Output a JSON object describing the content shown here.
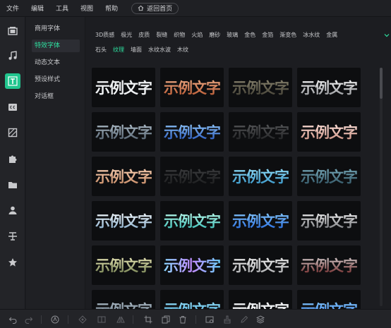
{
  "menubar": {
    "items": [
      "文件",
      "编辑",
      "工具",
      "视图",
      "帮助"
    ],
    "home_button": "返回首页"
  },
  "rail": {
    "items": [
      {
        "icon": "media-icon",
        "active": false
      },
      {
        "icon": "music-icon",
        "active": false
      },
      {
        "icon": "text-icon",
        "active": true
      },
      {
        "icon": "subtitle-icon",
        "active": false
      },
      {
        "icon": "filter-icon",
        "active": false
      },
      {
        "icon": "plugin-icon",
        "active": false
      },
      {
        "icon": "folder-icon",
        "active": false
      },
      {
        "icon": "person-icon",
        "active": false
      },
      {
        "icon": "split-text-icon",
        "active": false
      },
      {
        "icon": "star-icon",
        "active": false
      }
    ]
  },
  "categories": {
    "items": [
      "商用字体",
      "特效字体",
      "动态文本",
      "预设样式",
      "对话框"
    ],
    "active_index": 1
  },
  "subtabs": {
    "row1": [
      "3D质感",
      "极光",
      "皮质",
      "裂缝",
      "织物",
      "火焰",
      "磨砂",
      "玻璃",
      "金色",
      "金箔",
      "渐变色",
      "冰水纹",
      "金属"
    ],
    "row2": [
      "石头",
      "纹理",
      "墙面",
      "水纹水波",
      "木纹"
    ],
    "active": "纹理"
  },
  "tiles": {
    "sample_text": "示例文字",
    "styles": [
      "s-white",
      "s-copper",
      "s-olive",
      "s-silver",
      "s-steel",
      "s-blue",
      "s-dark",
      "s-pink",
      "s-peach",
      "s-char",
      "s-cyan",
      "s-teal",
      "s-ice",
      "s-aqua",
      "s-royal",
      "s-chrome",
      "s-gold",
      "s-iris",
      "s-grey",
      "s-ruby",
      "s-steel",
      "s-cyan",
      "s-white",
      "s-royal"
    ]
  },
  "colors": {
    "accent": "#21c58e",
    "accent_text": "#2ee0a0",
    "background": "#1c1d21",
    "panel": "#1f2024",
    "tile": "#0d0e10"
  },
  "toolbar": {
    "icons": [
      "undo-icon",
      "redo-icon",
      "audio-detach-icon",
      "keyframe-icon",
      "split-icon",
      "mirror-icon",
      "crop-icon",
      "copy-icon",
      "delete-icon",
      "snapshot-icon",
      "paint-icon",
      "edit-icon",
      "layers-icon"
    ]
  }
}
